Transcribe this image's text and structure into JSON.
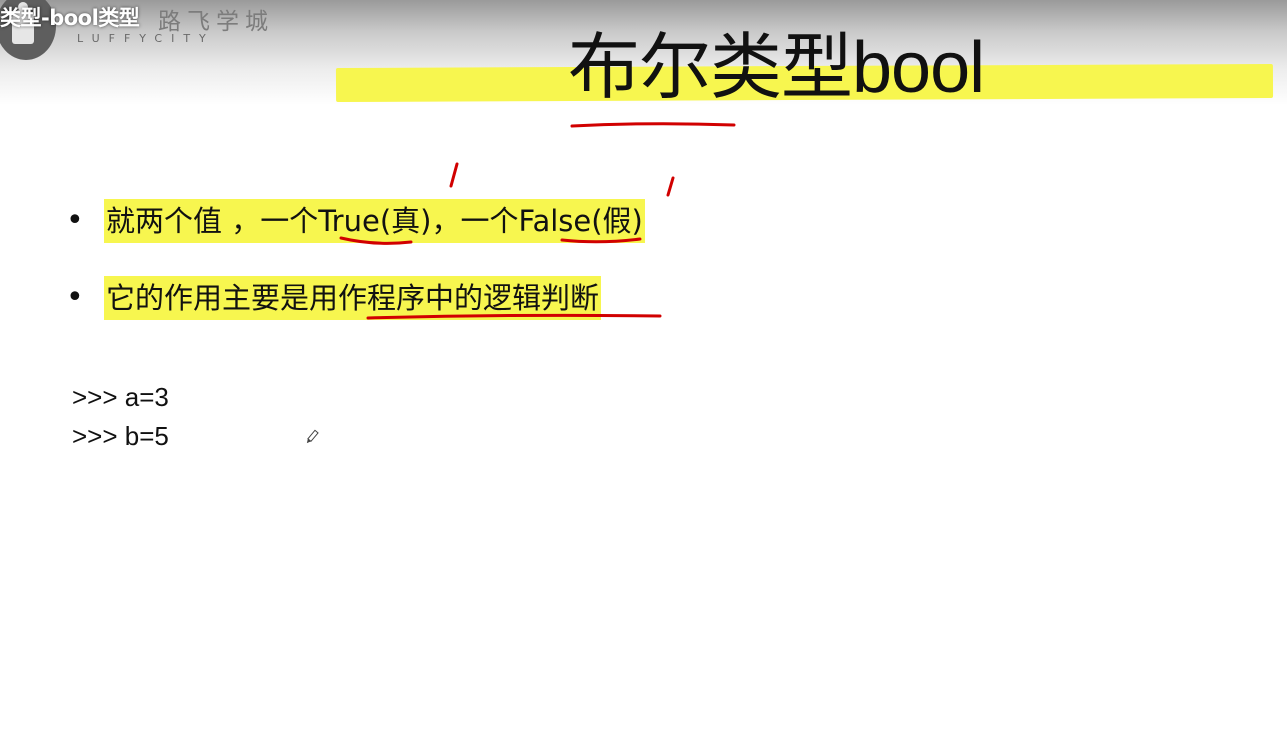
{
  "header": {
    "video_title": "类型-bool类型",
    "brand_cn": "路飞学城",
    "brand_en": "LUFFYCITY"
  },
  "slide": {
    "title": "布尔类型bool",
    "bullets": [
      "就两个值 ，一个True(真)，一个False(假)",
      "它的作用主要是用作程序中的逻辑判断"
    ],
    "bullet_marker": "•",
    "code_lines": [
      ">>> a=3",
      ">>> b=5"
    ]
  },
  "colors": {
    "highlight": "#f7f64f",
    "annotation_ink": "#d10000"
  },
  "icons": [
    "luffycity-logo-icon",
    "pen-cursor-icon"
  ]
}
